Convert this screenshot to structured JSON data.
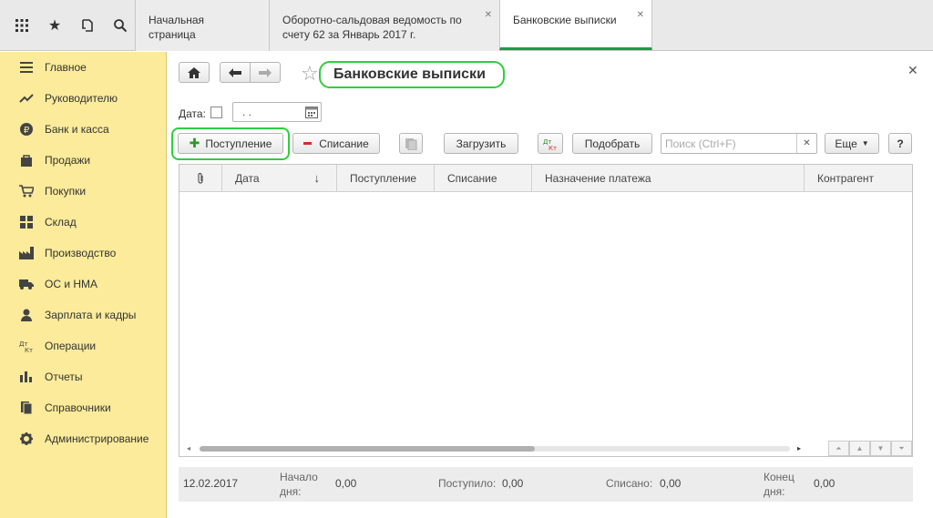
{
  "topbar": {
    "icons": [
      "grid-icon",
      "star-icon",
      "history-icon",
      "search-icon"
    ],
    "tabs": [
      {
        "label": "Начальная страница"
      },
      {
        "label": "Оборотно-сальдовая ведомость по счету 62 за Январь 2017 г.",
        "line1": "Оборотно-сальдовая ведомость по",
        "line2": "счету 62 за Январь 2017 г."
      },
      {
        "label": "Банковские выписки"
      }
    ]
  },
  "sidebar": {
    "items": [
      {
        "label": "Главное",
        "icon": "menu-icon"
      },
      {
        "label": "Руководителю",
        "icon": "trend-icon"
      },
      {
        "label": "Банк и касса",
        "icon": "ruble-icon"
      },
      {
        "label": "Продажи",
        "icon": "bag-icon"
      },
      {
        "label": "Покупки",
        "icon": "cart-icon"
      },
      {
        "label": "Склад",
        "icon": "warehouse-icon"
      },
      {
        "label": "Производство",
        "icon": "factory-icon"
      },
      {
        "label": "ОС и НМА",
        "icon": "truck-icon"
      },
      {
        "label": "Зарплата и кадры",
        "icon": "person-icon"
      },
      {
        "label": "Операции",
        "icon": "dt-kt-icon"
      },
      {
        "label": "Отчеты",
        "icon": "bar-chart-icon"
      },
      {
        "label": "Справочники",
        "icon": "book-icon"
      },
      {
        "label": "Администрирование",
        "icon": "gear-icon"
      }
    ]
  },
  "main": {
    "title": "Банковские выписки",
    "date_label": "Дата:",
    "date_value": " .  .",
    "toolbar": {
      "receipt": "Поступление",
      "writeoff": "Списание",
      "load": "Загрузить",
      "dtkt": "Дт Кт",
      "select": "Подобрать",
      "search_placeholder": "Поиск (Ctrl+F)",
      "more": "Еще",
      "help": "?"
    },
    "columns": [
      "Дата",
      "Поступление",
      "Списание",
      "Назначение платежа",
      "Контрагент"
    ],
    "footer": {
      "date": "12.02.2017",
      "start_label_1": "Начало",
      "start_label_2": "дня:",
      "start_value": "0,00",
      "received_label": "Поступило:",
      "received_value": "0,00",
      "spent_label": "Списано:",
      "spent_value": "0,00",
      "end_label_1": "Конец",
      "end_label_2": "дня:",
      "end_value": "0,00"
    }
  }
}
